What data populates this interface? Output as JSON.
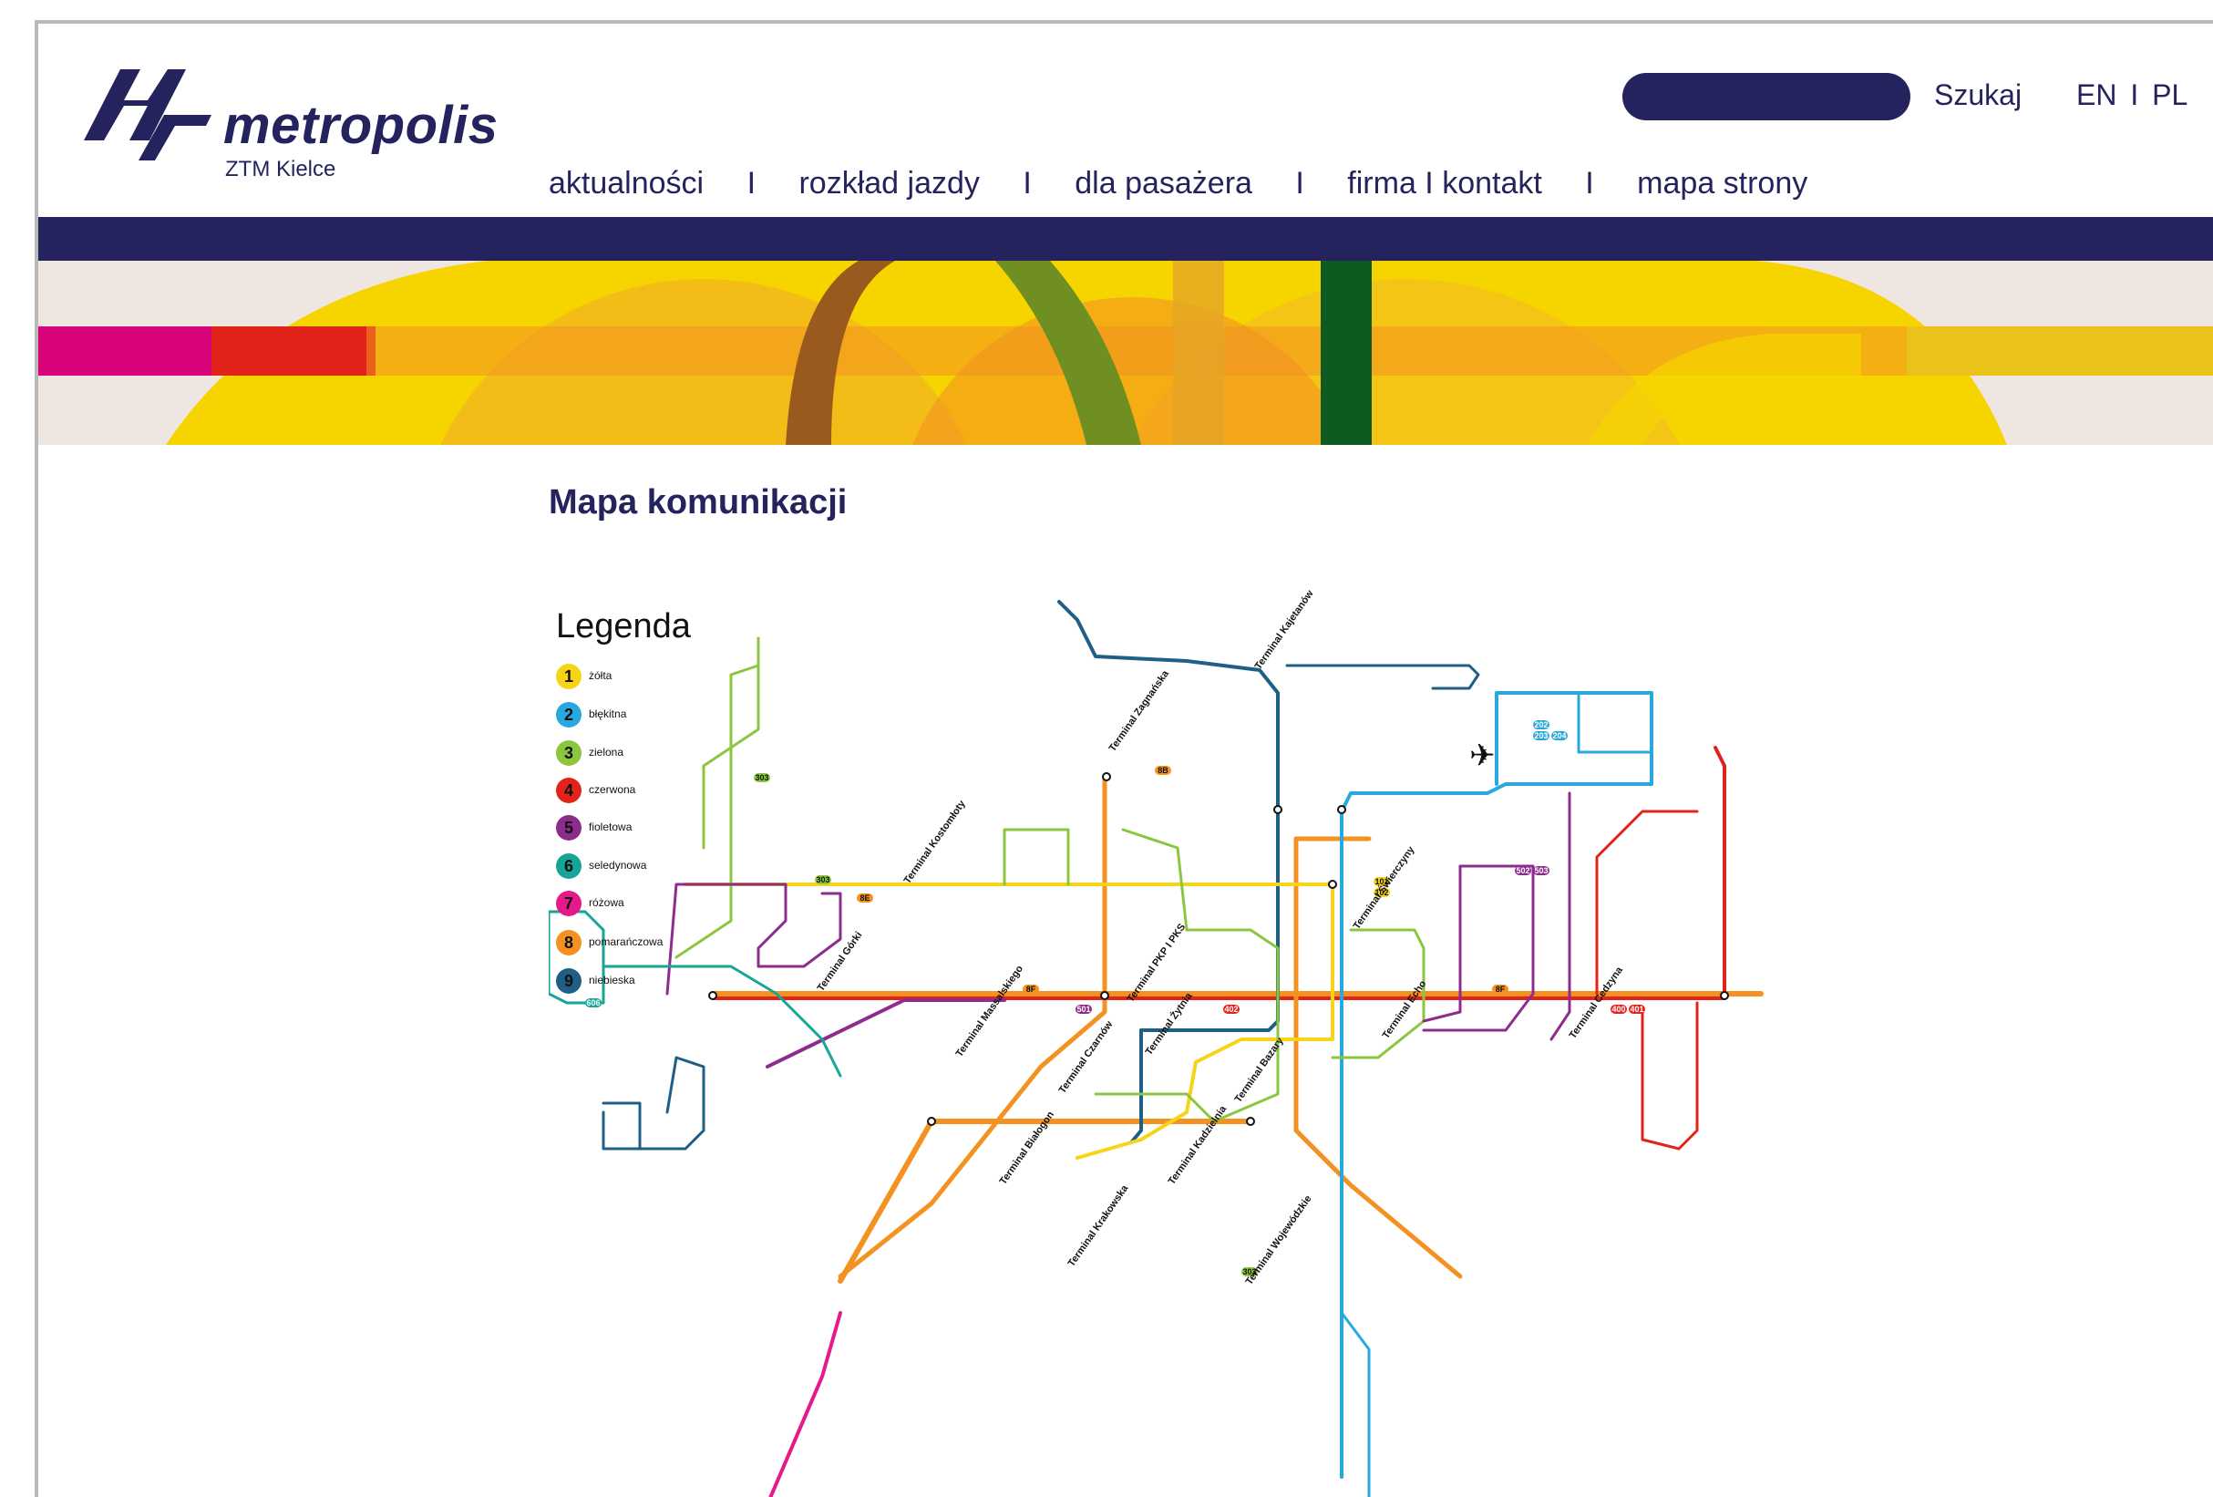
{
  "header": {
    "logo_name": "metropolis",
    "logo_sub": "ZTM Kielce",
    "search_placeholder": "",
    "search_label": "Szukaj",
    "lang_en": "EN",
    "lang_sep": "I",
    "lang_pl": "PL"
  },
  "nav": {
    "items": [
      "aktualności",
      "rozkład jazdy",
      "dla pasażera",
      "firma I kontakt",
      "mapa strony"
    ],
    "separator": "I"
  },
  "main": {
    "title": "Mapa komunikacji"
  },
  "legend": {
    "title": "Legenda",
    "lines": [
      {
        "num": "1",
        "name": "żółta",
        "color": "#f7d417"
      },
      {
        "num": "2",
        "name": "błękitna",
        "color": "#29a8df"
      },
      {
        "num": "3",
        "name": "zielona",
        "color": "#8cc63f"
      },
      {
        "num": "4",
        "name": "czerwona",
        "color": "#e2231a"
      },
      {
        "num": "5",
        "name": "fioletowa",
        "color": "#8e2c8e"
      },
      {
        "num": "6",
        "name": "seledynowa",
        "color": "#17a597"
      },
      {
        "num": "7",
        "name": "różowa",
        "color": "#e6198a"
      },
      {
        "num": "8",
        "name": "pomarańczowa",
        "color": "#f39220"
      },
      {
        "num": "9",
        "name": "niebieska",
        "color": "#1f5f86"
      }
    ]
  },
  "map_labels": {
    "terminals": [
      "Terminal Zagnańska",
      "Terminal Kajetanów",
      "Terminal Świerczyny",
      "Terminal Kostomłoty",
      "Terminal Echo",
      "Terminal Górki",
      "Terminal PKP I PKS",
      "Terminal Massalskiego",
      "Terminal Żytnia",
      "Terminal Czarnów",
      "Terminal Bazary",
      "Terminal Cedzyna",
      "Terminal Białogon",
      "Terminal Kadzielnia",
      "Terminal Krakowska",
      "Terminal Wojewódzkie"
    ]
  },
  "colors": {
    "navy": "#25235e",
    "banner_yellow": "#f6d400",
    "banner_orange": "#f39220",
    "banner_magenta": "#d9047c",
    "banner_green": "#0f5a21"
  }
}
